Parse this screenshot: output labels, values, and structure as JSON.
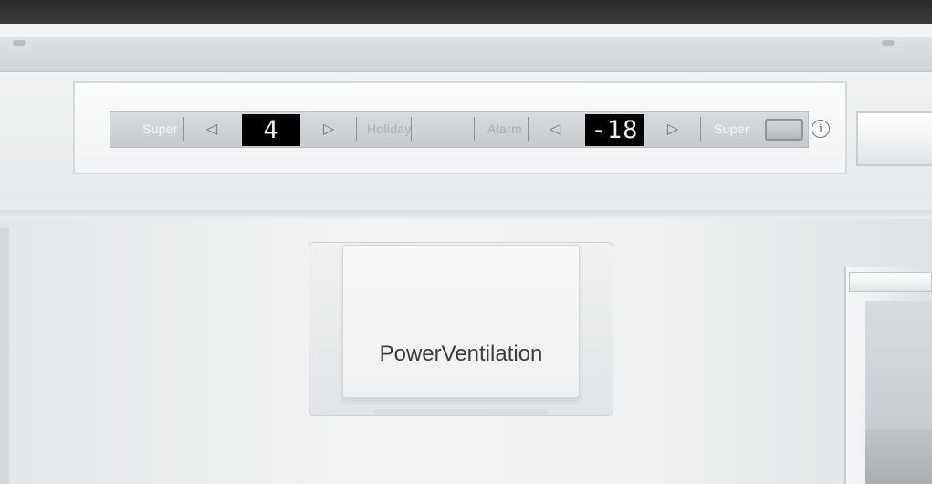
{
  "control_panel": {
    "left_super_label": "Super",
    "fridge_temp": "4",
    "holiday_label": "Holiday",
    "alarm_label": "Alarm",
    "freezer_temp": "-18",
    "right_super_label": "Super",
    "info_symbol": "i"
  },
  "icons": {
    "decrease": "left-triangle-icon",
    "increase": "right-triangle-icon",
    "info": "info-icon"
  },
  "vent": {
    "label": "PowerVentilation"
  }
}
